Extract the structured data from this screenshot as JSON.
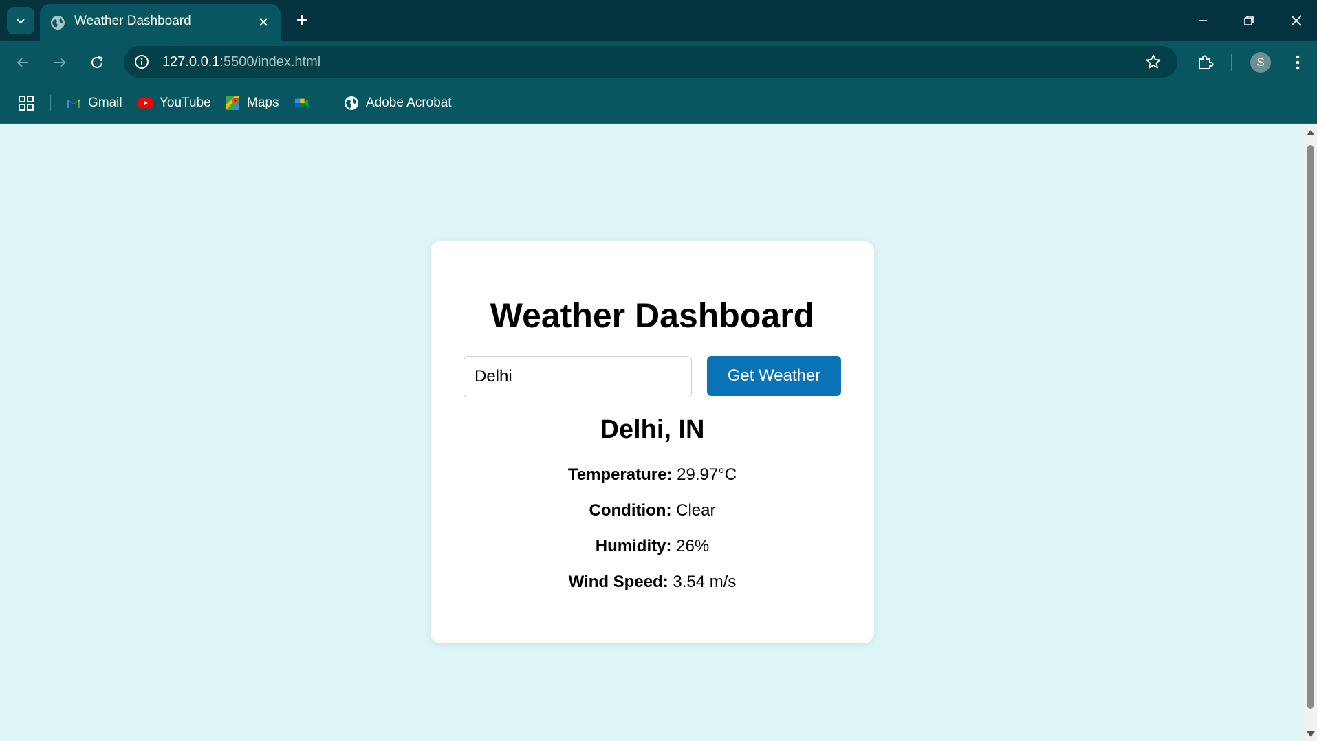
{
  "browser": {
    "tab_title": "Weather Dashboard",
    "url_host": "127.0.0.1",
    "url_path": ":5500/index.html",
    "profile_initial": "S",
    "bookmarks": [
      {
        "label": "Gmail",
        "icon": "gmail-icon"
      },
      {
        "label": "YouTube",
        "icon": "youtube-icon"
      },
      {
        "label": "Maps",
        "icon": "maps-icon"
      },
      {
        "label": "",
        "icon": "google-meet-icon"
      },
      {
        "label": "Adobe Acrobat",
        "icon": "globe-icon"
      }
    ]
  },
  "page": {
    "title": "Weather Dashboard",
    "search": {
      "value": "Delhi"
    },
    "button_label": "Get Weather",
    "result": {
      "city": "Delhi, IN",
      "temperature_label": "Temperature:",
      "temperature_value": "29.97°C",
      "condition_label": "Condition:",
      "condition_value": "Clear",
      "humidity_label": "Humidity:",
      "humidity_value": "26%",
      "wind_label": "Wind Speed:",
      "wind_value": "3.54 m/s"
    }
  },
  "colors": {
    "page_background": "#ddf5f7",
    "card_background": "#ffffff",
    "button": "#0a72b6",
    "chrome_dark": "#04333f",
    "chrome": "#075660"
  }
}
